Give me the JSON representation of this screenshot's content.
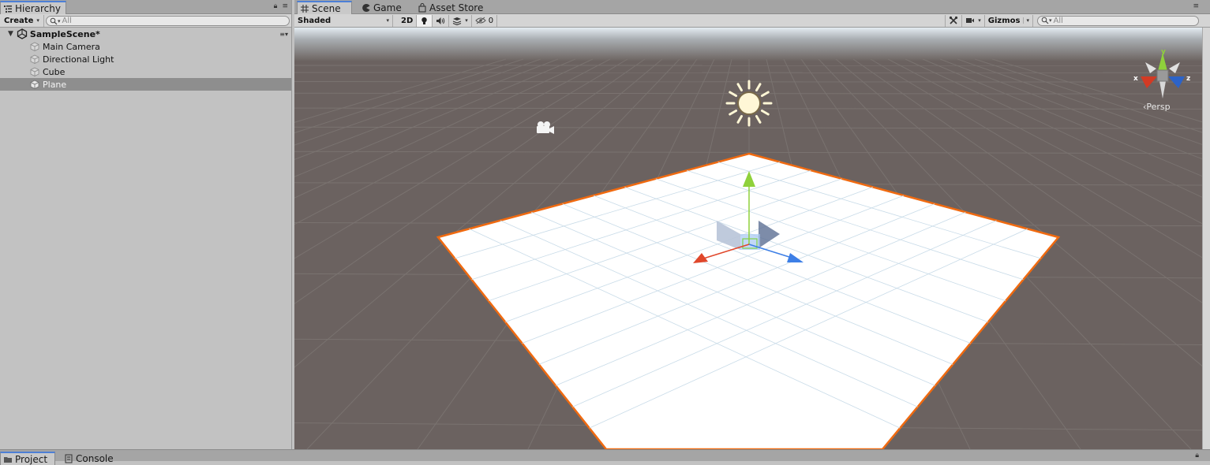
{
  "hierarchy": {
    "tab_label": "Hierarchy",
    "create_label": "Create",
    "search_placeholder": "All",
    "scene_name": "SampleScene*",
    "objects": [
      {
        "label": "Main Camera",
        "selected": false
      },
      {
        "label": "Directional Light",
        "selected": false
      },
      {
        "label": "Cube",
        "selected": false
      },
      {
        "label": "Plane",
        "selected": true
      }
    ]
  },
  "scene_view": {
    "tabs": [
      {
        "label": "Scene",
        "icon": "grid-icon",
        "active": true
      },
      {
        "label": "Game",
        "icon": "pacman-icon",
        "active": false
      },
      {
        "label": "Asset Store",
        "icon": "store-bag-icon",
        "active": false
      }
    ],
    "shading_mode": "Shaded",
    "mode_2d_label": "2D",
    "hidden_count": "0",
    "gizmos_label": "Gizmos",
    "search_placeholder": "All",
    "projection_label": "Persp",
    "axis_labels": {
      "x": "x",
      "y": "y",
      "z": "z"
    },
    "colors": {
      "background": "#6b6260",
      "horizon": "#a9aeb2",
      "plane": "#ffffff",
      "selection_outline": "#f06a10",
      "axis_x": "#e0472b",
      "axis_y": "#8fd13b",
      "axis_z": "#3d7fe6"
    }
  },
  "bottom_tabs": [
    {
      "label": "Project",
      "icon": "folder-icon"
    },
    {
      "label": "Console",
      "icon": "console-icon"
    }
  ]
}
